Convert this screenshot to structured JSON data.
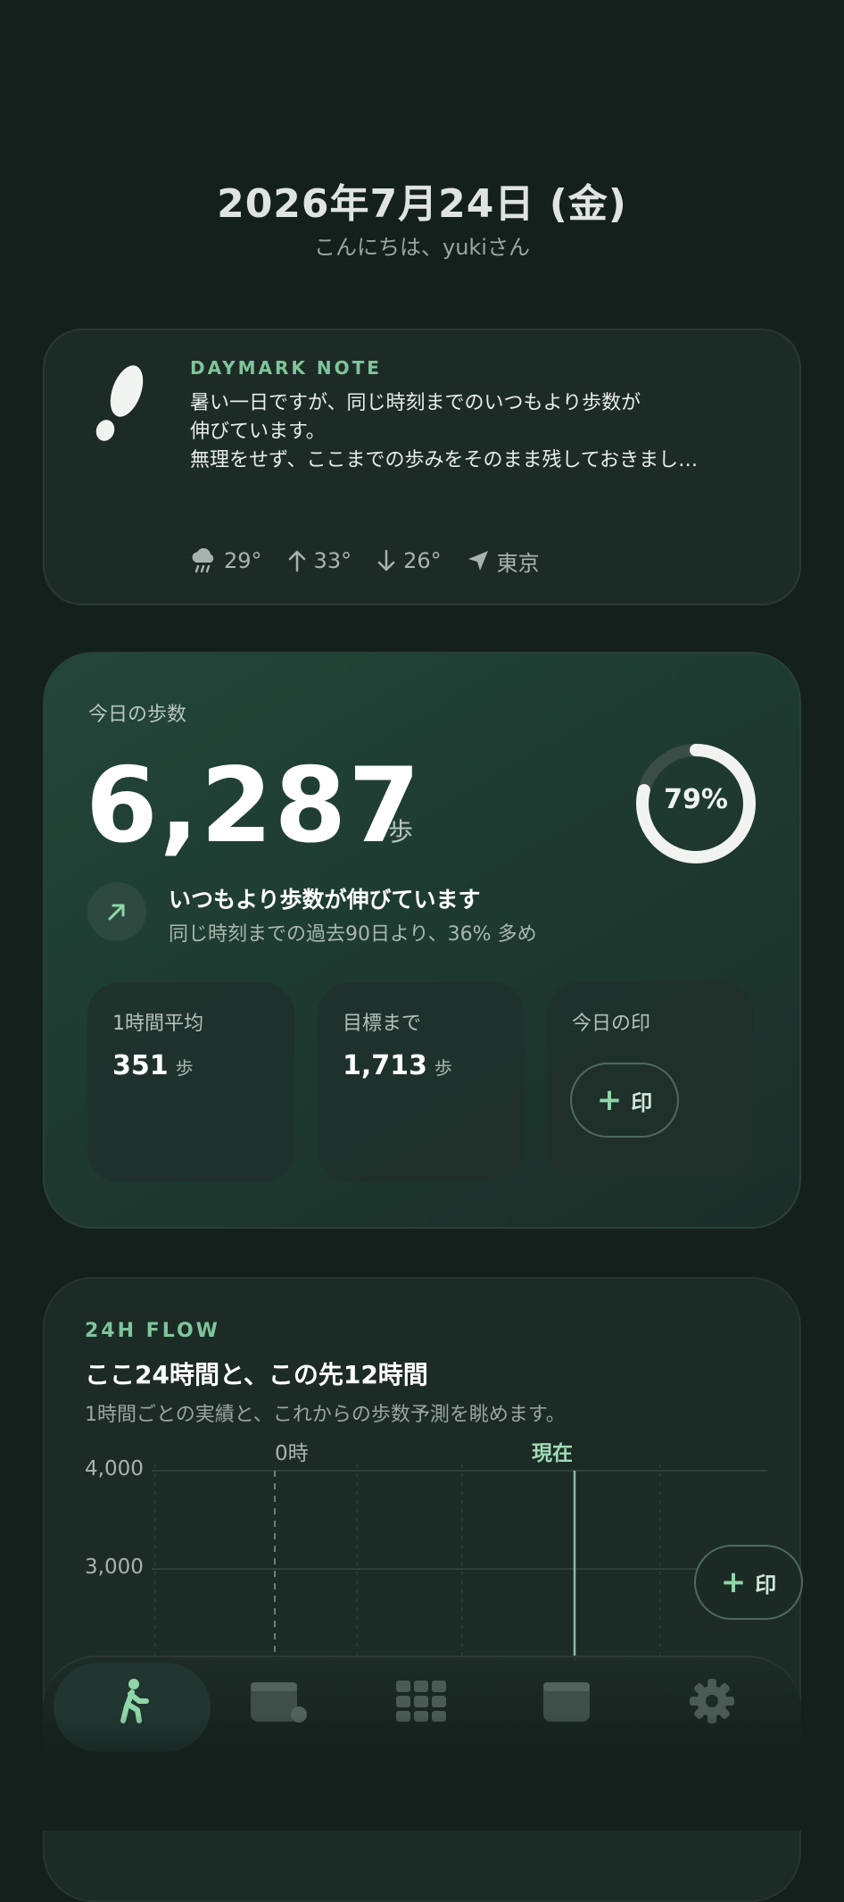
{
  "header": {
    "date": "2026年7月24日 (金)",
    "greeting": "こんにちは、yukiさん"
  },
  "note": {
    "label": "DAYMARK NOTE",
    "lines": [
      "暑い一日ですが、同じ時刻までのいつもより歩数が",
      "伸びています。",
      "無理をせず、ここまでの歩みをそのまま残しておきまし…"
    ],
    "weather": {
      "current": "29°",
      "high": "33°",
      "low": "26°",
      "location": "東京",
      "icons": [
        "rain-cloud-icon",
        "arrow-up-icon",
        "arrow-down-icon",
        "location-arrow-icon"
      ]
    }
  },
  "steps": {
    "label": "今日の歩数",
    "value": "6,287",
    "unit": "歩",
    "progress_text": "79%",
    "progress": 0.79,
    "trend_title": "いつもより歩数が伸びています",
    "trend_sub": "同じ時刻までの過去90日より、36% 多め",
    "stats": {
      "hourly_label": "1時間平均",
      "hourly_value": "351",
      "hourly_unit": "歩",
      "remaining_label": "目標まで",
      "remaining_value": "1,713",
      "remaining_unit": "歩",
      "stamp_label": "今日の印",
      "stamp_button": "印"
    }
  },
  "flow": {
    "label": "24H FLOW",
    "title": "ここ24時間と、この先12時間",
    "subtitle": "1時間ごとの実績と、これからの歩数予測を眺めます。",
    "marker_midnight": "0時",
    "marker_now": "現在",
    "y_ticks": [
      "4,000",
      "3,000"
    ],
    "float_button": "印"
  },
  "tabbar": {
    "tabs": [
      "walk-tab",
      "calendar-tab",
      "grid-tab",
      "calendar-tab-2",
      "settings-tab"
    ]
  },
  "colors": {
    "background": "#13201c",
    "accent": "#7fc59b",
    "card": "#1d2b27"
  }
}
